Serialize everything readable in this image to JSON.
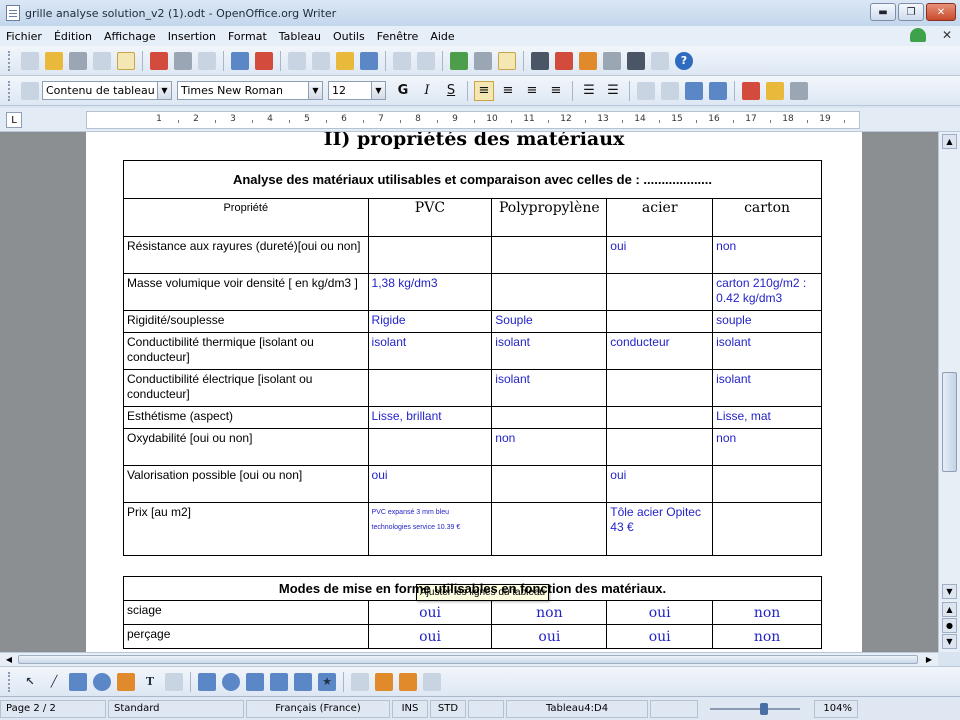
{
  "window": {
    "title": "grille analyse solution_v2 (1).odt - OpenOffice.org Writer",
    "min_label": "▬",
    "max_label": "❐",
    "close_label": "✕"
  },
  "menu": {
    "items": [
      "Fichier",
      "Édition",
      "Affichage",
      "Insertion",
      "Format",
      "Tableau",
      "Outils",
      "Fenêtre",
      "Aide"
    ],
    "close_doc": "✕"
  },
  "format_toolbar": {
    "style": "Contenu de tableau",
    "font": "Times New Roman",
    "size": "12",
    "bold": "G",
    "italic": "I",
    "underline": "S"
  },
  "ruler": {
    "tab_symbol": "L",
    "numbers": [
      "1",
      "2",
      "3",
      "4",
      "5",
      "6",
      "7",
      "8",
      "9",
      "10",
      "11",
      "12",
      "13",
      "14",
      "15",
      "16",
      "17",
      "18",
      "19"
    ]
  },
  "document": {
    "heading": "II)  propriétés des matériaux",
    "table1": {
      "title": "Analyse des matériaux utilisables et comparaison avec celles de : ...................",
      "headers": [
        "Propriété",
        "PVC",
        "Polypropylène",
        "acier",
        "carton"
      ],
      "rows": [
        [
          "Résistance aux rayures (dureté)[oui ou non]",
          "",
          "",
          "oui",
          "non"
        ],
        [
          "Masse volumique voir densité [ en kg/dm3 ]",
          "1,38  kg/dm3",
          "",
          "",
          "carton 210g/m2 : 0.42 kg/dm3"
        ],
        [
          "Rigidité/souplesse",
          "Rigide",
          "Souple",
          "",
          "souple"
        ],
        [
          "Conductibilité thermique [isolant ou conducteur]",
          "isolant",
          "isolant",
          "conducteur",
          "isolant"
        ],
        [
          "Conductibilité électrique [isolant ou conducteur]",
          "",
          "isolant",
          "",
          "isolant"
        ],
        [
          "Esthétisme (aspect)",
          "Lisse, brillant",
          "",
          "",
          "Lisse, mat"
        ],
        [
          "Oxydabilité [oui ou non]",
          "",
          "non",
          "",
          "non"
        ],
        [
          "Valorisation possible [oui ou non]",
          "oui",
          "",
          "oui",
          ""
        ],
        [
          "Prix [au m2]",
          "PVC expansé 3 mm bleu technologies service 10.39 €",
          "",
          "Tôle acier Opitec 43 €",
          ""
        ]
      ]
    },
    "tooltip": "Ajuster les lignes du tableau",
    "table2": {
      "title": "Modes de mise en forme  utilisables en fonction des matériaux.",
      "rows": [
        [
          "sciage",
          "oui",
          "non",
          "oui",
          "non"
        ],
        [
          "perçage",
          "oui",
          "oui",
          "oui",
          "non"
        ]
      ]
    }
  },
  "statusbar": {
    "page": "Page 2 / 2",
    "style": "Standard",
    "language": "Français (France)",
    "insert_mode": "INS",
    "selection_mode": "STD",
    "cell": "Tableau4:D4",
    "zoom": "104%"
  }
}
